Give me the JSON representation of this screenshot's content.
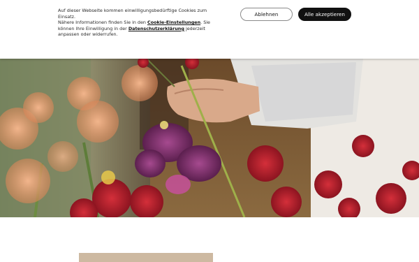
{
  "cookie_banner": {
    "text_line_1": "Auf dieser Webseite kommen einwilligungsbedürftige Cookies zum Einsatz.",
    "text_line_2_prefix": "Nähere Informationen finden Sie in den ",
    "cookie_settings_link": "Cookie-Einstellungen",
    "text_line_2_middle": ". Sie können Ihre Einwilligung in der ",
    "privacy_link": "Datenschutzerklärung",
    "text_line_2_suffix": " jederzeit anpassen oder widerrufen.",
    "decline_label": "Ablehnen",
    "accept_label": "Alle akzeptieren"
  },
  "hero": {
    "image_icon": "florist-flowers-photo"
  },
  "colors": {
    "accept_button": "#111111",
    "card_strip": "#cdb9a1"
  }
}
